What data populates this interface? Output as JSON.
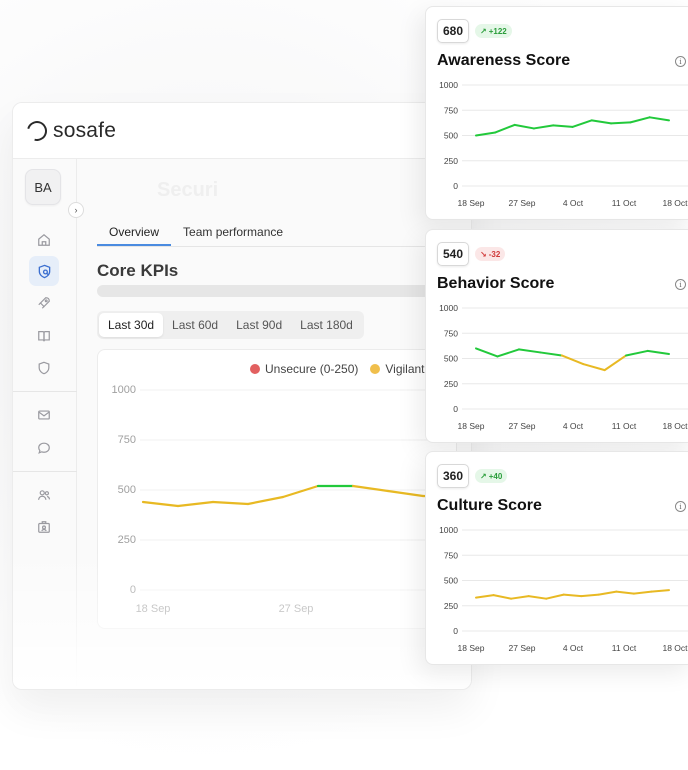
{
  "app": {
    "logo_text": "sosafe",
    "avatar_initials": "BA",
    "page_title": "Securi"
  },
  "tabs": [
    {
      "label": "Overview",
      "active": true
    },
    {
      "label": "Team performance",
      "active": false
    }
  ],
  "section_title": "Core KPIs",
  "time_ranges": [
    {
      "label": "Last 30d",
      "active": true
    },
    {
      "label": "Last 60d",
      "active": false
    },
    {
      "label": "Last 90d",
      "active": false
    },
    {
      "label": "Last 180d",
      "active": false
    }
  ],
  "nav_icons": [
    "home-icon",
    "shield-search-icon",
    "rocket-icon",
    "book-icon",
    "shield-icon",
    "mail-icon",
    "chat-icon",
    "users-icon",
    "badge-icon"
  ],
  "colors": {
    "green": "#22c93b",
    "yellow": "#e8b923",
    "red": "#e26060",
    "accent": "#4a8be0"
  },
  "kpi_chart": {
    "legend": [
      {
        "label": "Unsecure (0-250)",
        "color": "#e26060"
      },
      {
        "label": "Vigilant",
        "color": "#f0bf4c"
      }
    ]
  },
  "chart_data": [
    {
      "type": "line",
      "title": "",
      "ylim": [
        0,
        1000
      ],
      "yticks": [
        0,
        250,
        500,
        750,
        1000
      ],
      "x_tick_labels": [
        "18 Sep",
        "27 Sep"
      ],
      "series": [
        {
          "values": [
            440,
            420,
            440,
            430,
            465,
            520,
            520,
            495,
            470,
            465
          ]
        }
      ]
    },
    {
      "type": "line",
      "title": "Awareness Score",
      "score": "680",
      "delta": "+122",
      "trend": "up",
      "ylim": [
        0,
        1000
      ],
      "yticks": [
        0,
        250,
        500,
        750,
        1000
      ],
      "x_tick_labels": [
        "18 Sep",
        "27 Sep",
        "4 Oct",
        "11 Oct",
        "18 Oct"
      ],
      "series": [
        {
          "values": [
            500,
            530,
            605,
            570,
            600,
            585,
            650,
            620,
            630,
            680,
            650
          ]
        }
      ]
    },
    {
      "type": "line",
      "title": "Behavior Score",
      "score": "540",
      "delta": "-32",
      "trend": "down",
      "ylim": [
        0,
        1000
      ],
      "yticks": [
        0,
        250,
        500,
        750,
        1000
      ],
      "x_tick_labels": [
        "18 Sep",
        "27 Sep",
        "4 Oct",
        "11 Oct",
        "18 Oct"
      ],
      "series": [
        {
          "values": [
            600,
            520,
            590,
            560,
            530,
            445,
            385,
            530,
            575,
            545
          ]
        }
      ]
    },
    {
      "type": "line",
      "title": "Culture Score",
      "score": "360",
      "delta": "+40",
      "trend": "up",
      "ylim": [
        0,
        1000
      ],
      "yticks": [
        0,
        250,
        500,
        750,
        1000
      ],
      "x_tick_labels": [
        "18 Sep",
        "27 Sep",
        "4 Oct",
        "11 Oct",
        "18 Oct"
      ],
      "series": [
        {
          "values": [
            330,
            355,
            320,
            345,
            320,
            360,
            345,
            360,
            390,
            370,
            390,
            405
          ]
        }
      ]
    }
  ]
}
